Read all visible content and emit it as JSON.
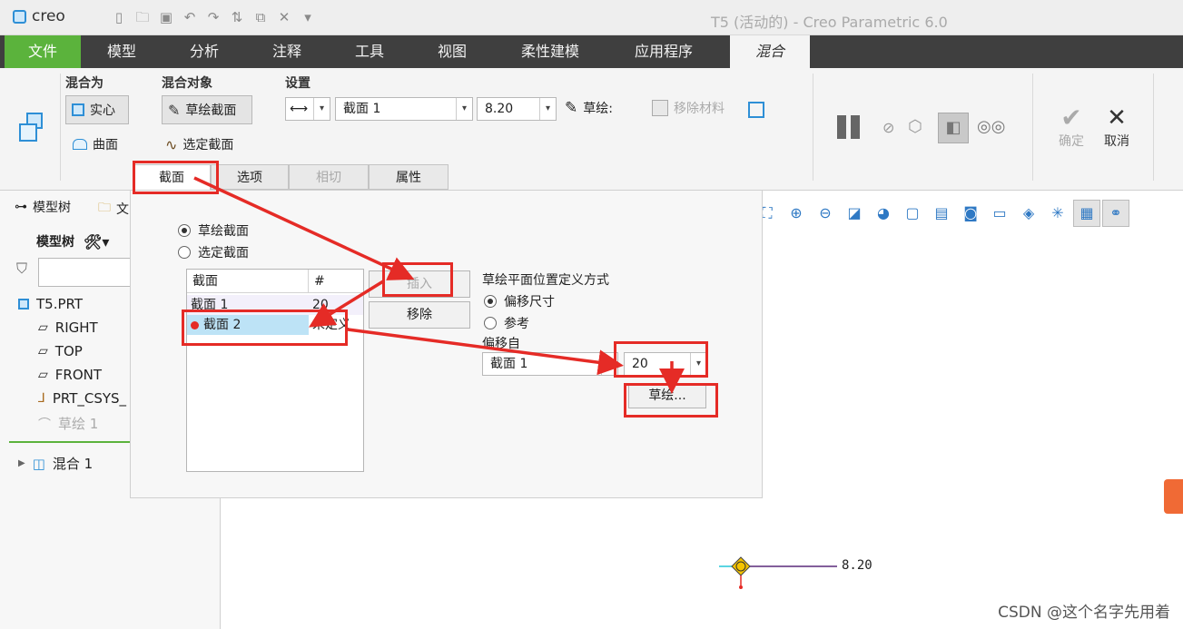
{
  "app": {
    "logo": "creo",
    "title": "T5 (活动的) - Creo Parametric 6.0"
  },
  "ribbon_tabs": [
    "文件",
    "模型",
    "分析",
    "注释",
    "工具",
    "视图",
    "柔性建模",
    "应用程序",
    "混合"
  ],
  "ribbon": {
    "group_blend_as": {
      "label": "混合为",
      "solid": "实心",
      "surface": "曲面"
    },
    "group_blend_obj": {
      "label": "混合对象",
      "sketch_sec": "草绘截面",
      "select_sec": "选定截面"
    },
    "group_settings": {
      "label": "设置",
      "section_value": "截面 1",
      "depth_value": "8.20",
      "sketch_label": "草绘:",
      "remove_material": "移除材料"
    },
    "confirm": "确定",
    "cancel": "取消"
  },
  "subtabs": [
    "截面",
    "选项",
    "相切",
    "属性"
  ],
  "left_panel": {
    "tabs": [
      "模型树",
      "文"
    ],
    "tree_header": "模型树",
    "items": [
      "T5.PRT",
      "RIGHT",
      "TOP",
      "FRONT",
      "PRT_CSYS_",
      "草绘 1",
      "混合 1"
    ]
  },
  "popup": {
    "radio_sketch": "草绘截面",
    "radio_select": "选定截面",
    "table": {
      "col1": "截面",
      "col2": "#",
      "rows": [
        {
          "name": "截面 1",
          "num": "20"
        },
        {
          "name": "截面 2",
          "num": "未定义"
        }
      ]
    },
    "insert": "插入",
    "remove": "移除",
    "plane_def_label": "草绘平面位置定义方式",
    "opt_offset": "偏移尺寸",
    "opt_ref": "参考",
    "offset_from_label": "偏移自",
    "offset_from_value": "截面 1",
    "offset_value": "20",
    "sketch_btn": "草绘..."
  },
  "canvas": {
    "dim_label": "8.20"
  },
  "watermark": "CSDN @这个名字先用着",
  "colors": {
    "accent_green": "#5bb33c",
    "annotation_red": "#e52b26",
    "tab_bar": "#3f3f3f"
  }
}
